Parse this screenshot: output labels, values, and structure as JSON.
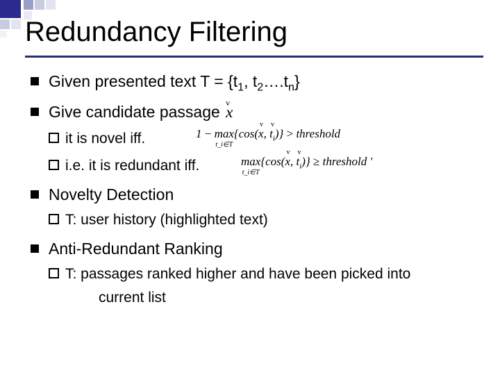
{
  "title": "Redundancy Filtering",
  "bullets": {
    "b1": "Given presented text T = {t",
    "b1_sub1": "1",
    "b1_mid1": ", t",
    "b1_sub2": "2",
    "b1_mid2": "….t",
    "b1_subn": "n",
    "b1_end": "}",
    "b2": "Give candidate passage ",
    "b2_math_x": "x",
    "b2_arrow": "v",
    "sub1": "it is novel iff.",
    "sub2": "i.e. it is redundant iff.",
    "b3": "Novelty Detection",
    "b3_sub": "T: user history (highlighted text)",
    "b4": "Anti-Redundant Ranking",
    "b4_sub": "T: passages ranked higher and have been picked into",
    "b4_sub_line2": "current list"
  },
  "formulas": {
    "f1_text": "1 − max{cos(x, t_i)} > threshold",
    "f1_under": "t_i ∈ T",
    "f2_text": "max{cos(x, t_i)} ≥ threshold '",
    "f2_under": "t_i ∈ T"
  }
}
